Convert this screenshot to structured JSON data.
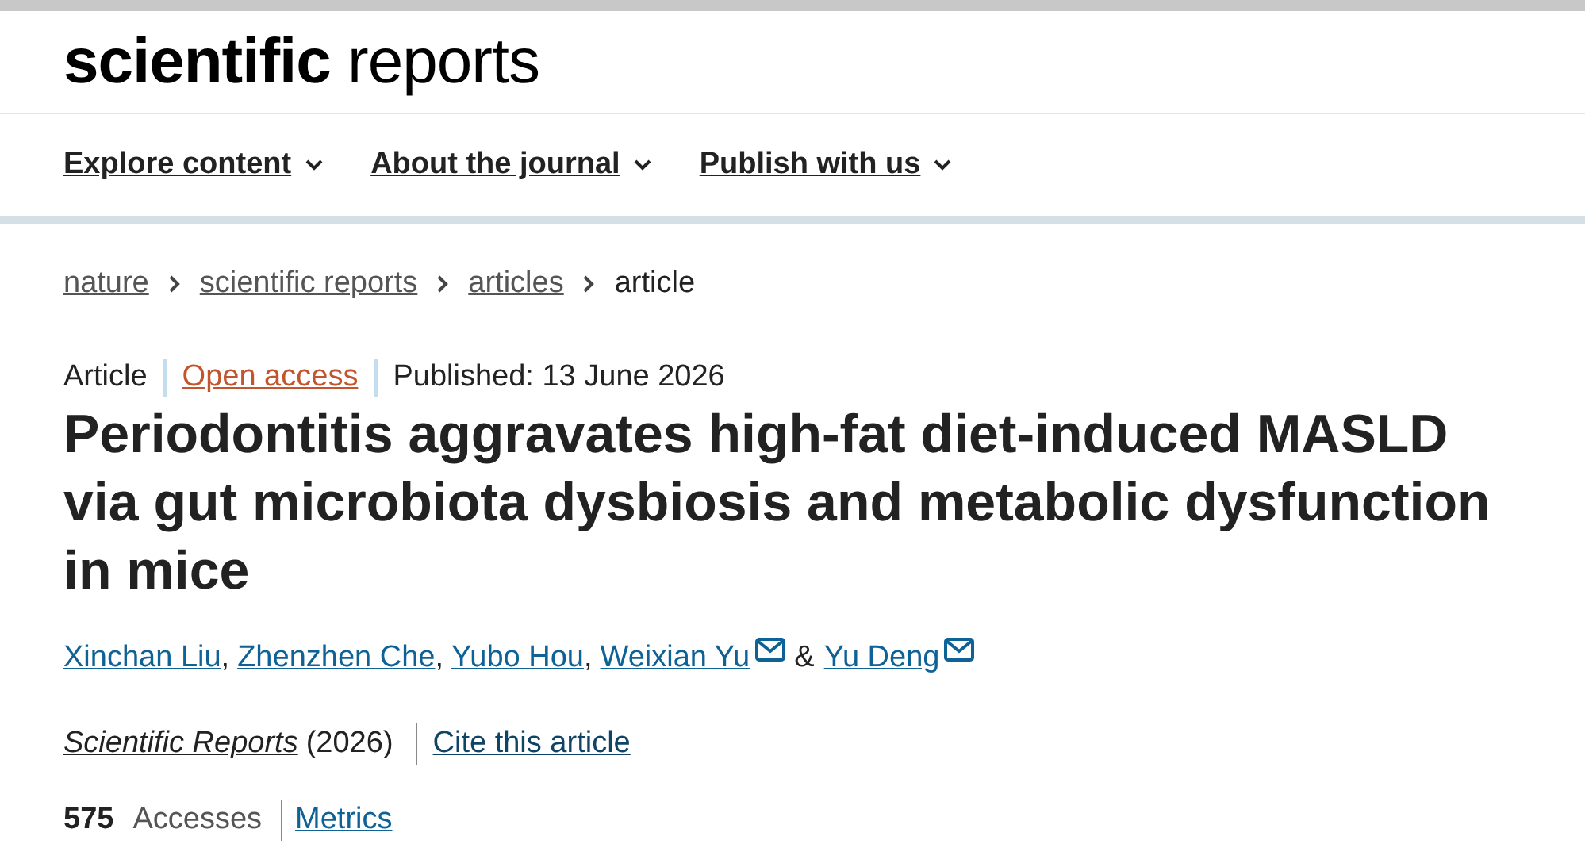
{
  "logo": "**scientific** reports",
  "nav": [
    {
      "label": "Explore content"
    },
    {
      "label": "About the journal"
    },
    {
      "label": "Publish with us"
    }
  ],
  "breadcrumb": [
    {
      "label": "nature",
      "current": false
    },
    {
      "label": "scientific reports",
      "current": false
    },
    {
      "label": "articles",
      "current": false
    },
    {
      "label": "article",
      "current": true
    }
  ],
  "meta": {
    "type": "Article",
    "access": "Open access",
    "published": "Published: 13 June 2026"
  },
  "title": "Periodontitis aggravates high-fat diet-induced MASLD via gut microbiota dysbiosis and metabolic dysfunction in mice",
  "authors": [
    {
      "name": "Xinchan Liu",
      "email": false,
      "separator": ","
    },
    {
      "name": "Zhenzhen Che",
      "email": false,
      "separator": ","
    },
    {
      "name": "Yubo Hou",
      "email": false,
      "separator": ","
    },
    {
      "name": "Weixian Yu",
      "email": true,
      "separator": "&"
    },
    {
      "name": "Yu Deng",
      "email": true
    }
  ],
  "citation": {
    "journal": "Scientific Reports",
    "year": "(2026)",
    "cite_link": "Cite this article"
  },
  "metrics": {
    "count": "575",
    "label": "Accesses",
    "link": "Metrics"
  }
}
